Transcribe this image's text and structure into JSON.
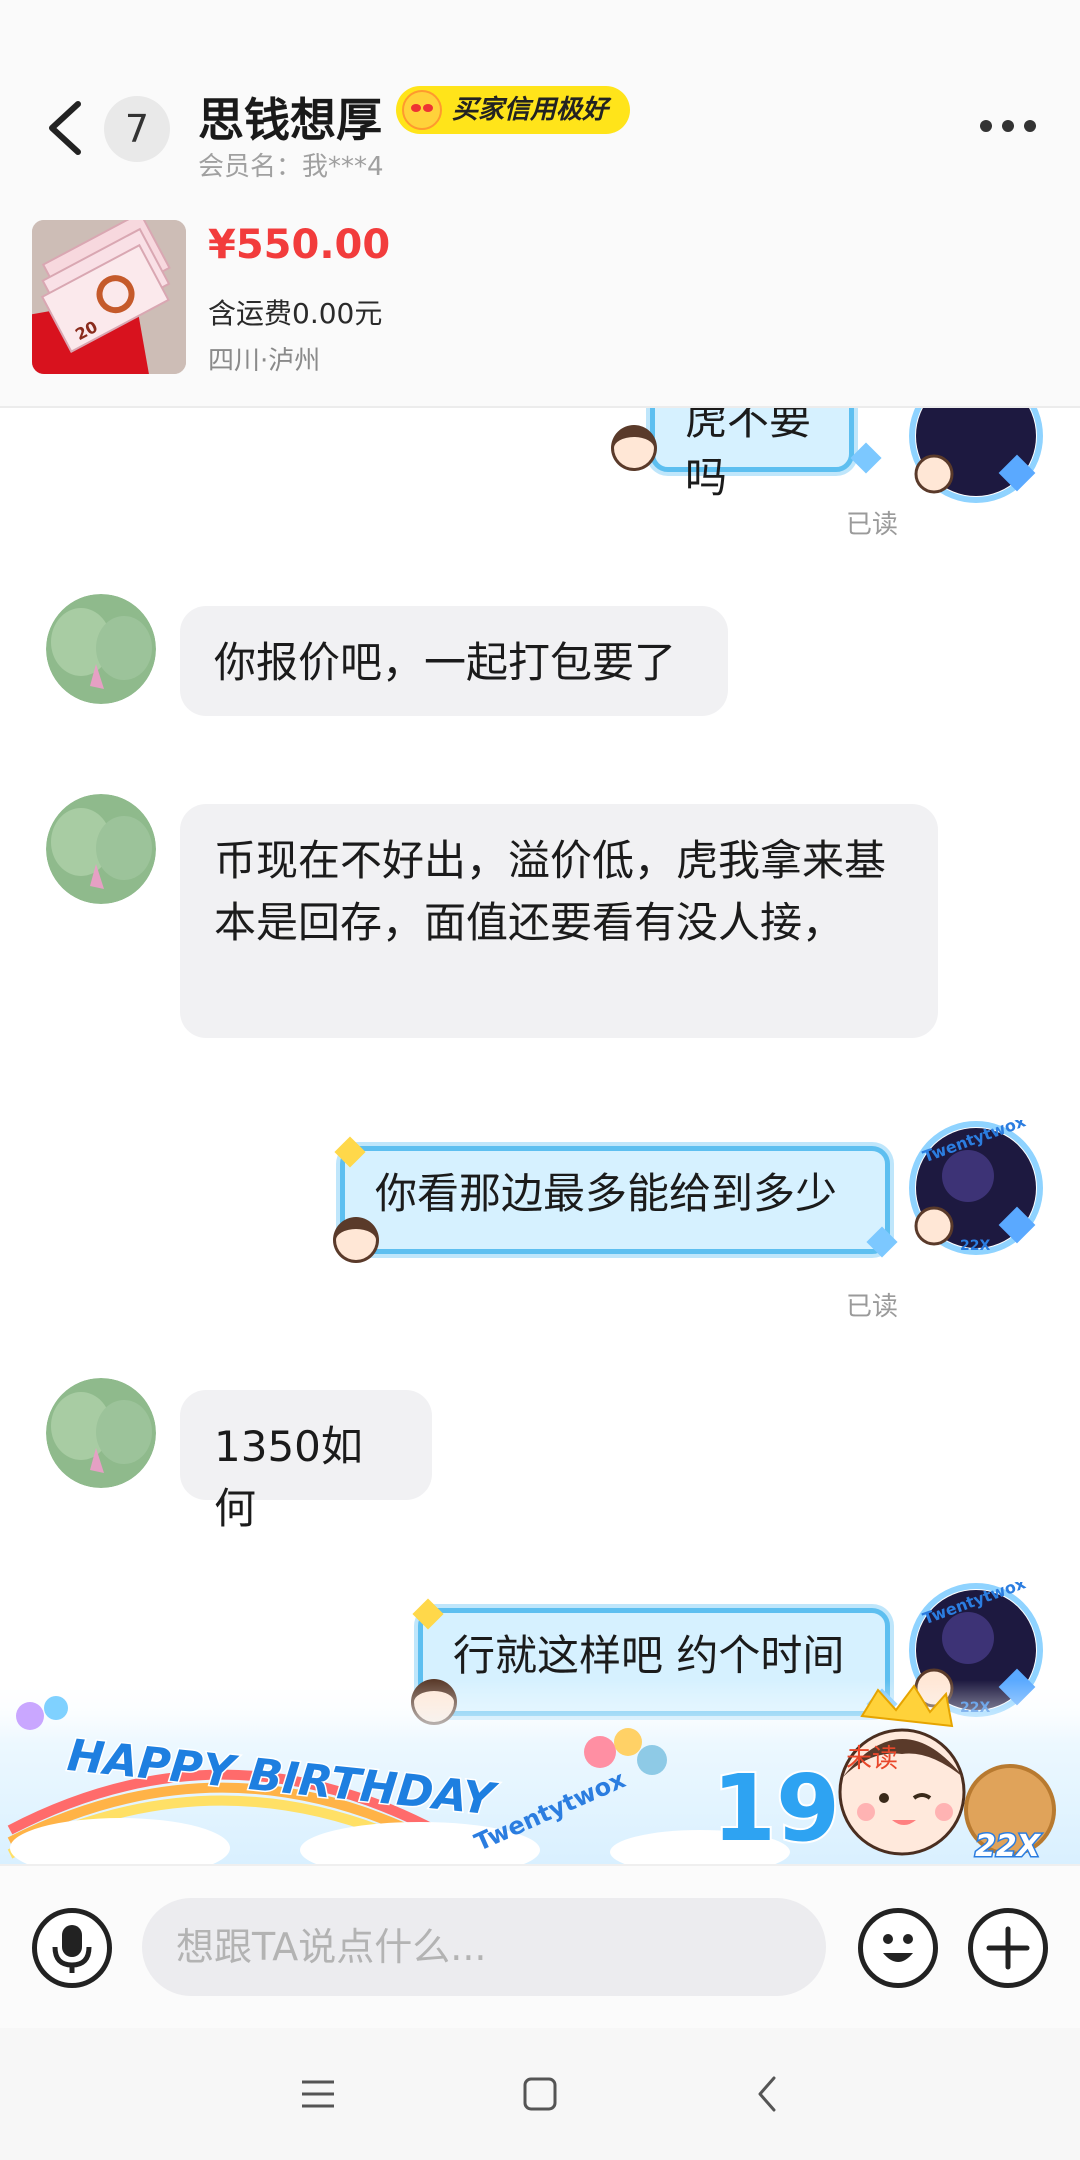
{
  "header": {
    "unread_count": "7",
    "seller_name": "思钱想厚",
    "credit_badge": "买家信用极好",
    "member_name": "会员名：我***4"
  },
  "product": {
    "price": "¥550.00",
    "shipping": "含运费0.00元",
    "location": "四川·泸州",
    "thumb_number": "20"
  },
  "messages": [
    {
      "side": "right",
      "text": "虎不要吗",
      "status": "已读"
    },
    {
      "side": "left",
      "text": "你报价吧，一起打包要了"
    },
    {
      "side": "left",
      "text": "币现在不好出，溢价低，虎我拿来基本是回存，面值还要看有没人接，"
    },
    {
      "side": "right",
      "text": "你看那边最多能给到多少",
      "status": "已读"
    },
    {
      "side": "left",
      "text": "1350如何"
    },
    {
      "side": "right",
      "text": "行就这样吧 约个时间",
      "status": "未读"
    }
  ],
  "avatar_right_text": "Twentytwox",
  "avatar_right_sub": "22X",
  "banner": {
    "text": "HAPPY BIRTHDAY",
    "brand": "Twentytwox",
    "number": "19",
    "tag": "22X"
  },
  "input": {
    "placeholder": "想跟TA说点什么..."
  },
  "colors": {
    "price": "#f23c3c",
    "badge": "#ffe41a",
    "bubble_right": "#d6f1ff",
    "bubble_right_border": "#5dbff0",
    "bubble_left": "#f1f1f3"
  }
}
